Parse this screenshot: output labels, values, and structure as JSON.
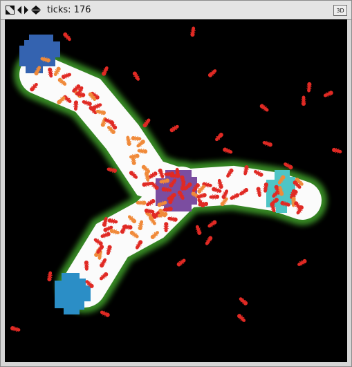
{
  "toolbar": {
    "zoom_icon": "zoom-diagonal-arrows-icon",
    "nav_lr_icon": "left-right-arrows-icon",
    "nav_ud_icon": "up-down-arrows-icon",
    "ticks_label": "ticks: 176",
    "view_3d_label": "3D"
  },
  "colors": {
    "background": "#000000",
    "trail": "#fbfbfb",
    "trail_glow": "#3fa02c",
    "nest": "#7b4da0",
    "food_dark_blue": "#3463b0",
    "food_cyan": "#4ec5c6",
    "food_mid_blue": "#2b8ec6",
    "ant_red": "#e02a24",
    "ant_orange": "#f08a3a"
  }
}
